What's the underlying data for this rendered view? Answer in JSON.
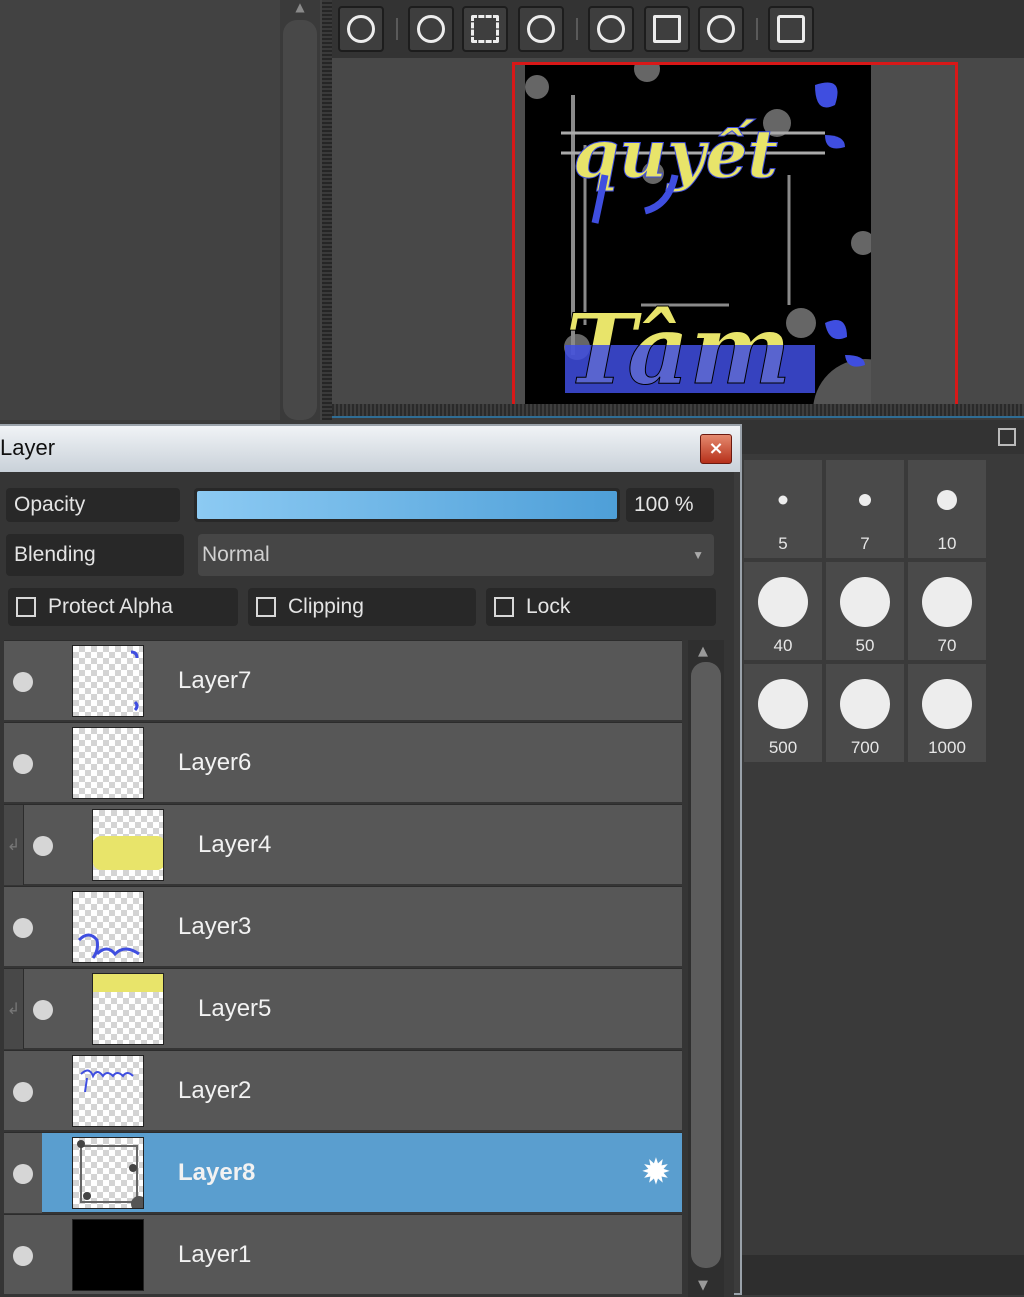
{
  "layer_panel": {
    "title": "Layer",
    "close_glyph": "×",
    "opacity_label": "Opacity",
    "opacity_value": "100 %",
    "opacity_percent": 100,
    "blending_label": "Blending",
    "blending_value": "Normal",
    "protect_alpha_label": "Protect Alpha",
    "clipping_label": "Clipping",
    "lock_label": "Lock",
    "layers": [
      {
        "name": "Layer7"
      },
      {
        "name": "Layer6"
      },
      {
        "name": "Layer4"
      },
      {
        "name": "Layer3"
      },
      {
        "name": "Layer5"
      },
      {
        "name": "Layer2"
      },
      {
        "name": "Layer8"
      },
      {
        "name": "Layer1"
      }
    ]
  },
  "brush_sizes": [
    "5",
    "7",
    "10",
    "40",
    "50",
    "70",
    "500",
    "700",
    "1000"
  ],
  "icons": {
    "toolbar": [
      "zoom-actual-icon",
      "zoom-in-icon",
      "fit-screen-icon",
      "zoom-out-icon",
      "rotate-left-icon",
      "fit-window-icon",
      "rotate-right-icon",
      "flip-horizontal-icon"
    ],
    "settings": "gear-icon",
    "popout": "popout-icon"
  },
  "colors": {
    "selected_row": "#5a9ecf",
    "opacity_fill": "#6bb4e6",
    "canvas_frame": "#d81818",
    "art_yellow": "#e8e46a",
    "art_blue": "#3f4ee0"
  }
}
